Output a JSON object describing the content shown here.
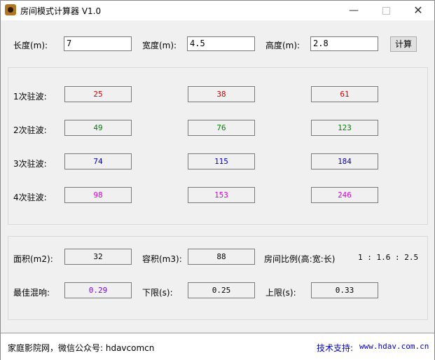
{
  "window": {
    "title": "房间模式计算器  V1.0",
    "icon": "app-icon",
    "controls": {
      "minimize": "—",
      "maximize": "☐",
      "close": "✕"
    }
  },
  "inputs": {
    "length_label": "长度(m):",
    "length_value": "7",
    "width_label": "宽度(m):",
    "width_value": "4.5",
    "height_label": "高度(m):",
    "height_value": "2.8",
    "calc_button": "计算"
  },
  "standing_waves": {
    "rows": [
      {
        "label": "1次驻波:",
        "values": [
          "25",
          "38",
          "61"
        ],
        "color": "#d40000"
      },
      {
        "label": "2次驻波:",
        "values": [
          "49",
          "76",
          "123"
        ],
        "color": "#008000"
      },
      {
        "label": "3次驻波:",
        "values": [
          "74",
          "115",
          "184"
        ],
        "color": "#0000d0"
      },
      {
        "label": "4次驻波:",
        "values": [
          "98",
          "153",
          "246"
        ],
        "color": "#e000e0"
      }
    ]
  },
  "results": {
    "area_label": "面积(m2):",
    "area_value": "32",
    "volume_label": "容积(m3):",
    "volume_value": "88",
    "ratio_label": "房间比例(高:宽:长)",
    "ratio_value": "1 : 1.6 : 2.5",
    "reverb_label": "最佳混响:",
    "reverb_value": "0.29",
    "reverb_color": "#8000ff",
    "lower_label": "下限(s):",
    "lower_value": "0.25",
    "upper_label": "上限(s):",
    "upper_value": "0.33"
  },
  "status": {
    "left": "家庭影院网，微信公众号: hdavcomcn",
    "support_label": "技术支持:",
    "support_link": "www.hdav.com.cn"
  }
}
